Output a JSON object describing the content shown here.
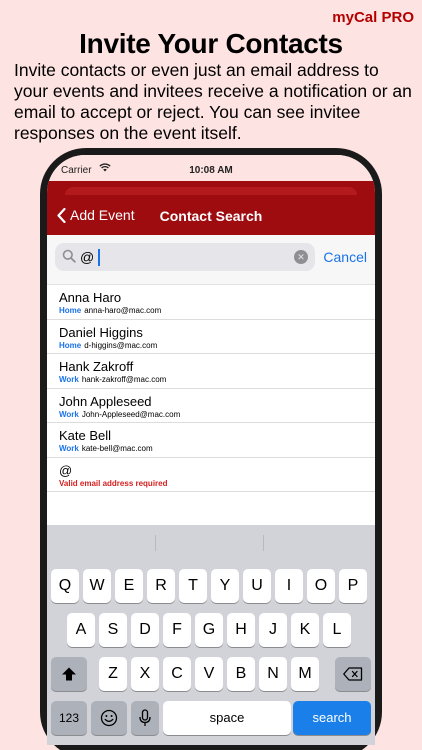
{
  "brand": "myCal PRO",
  "headline": "Invite Your Contacts",
  "description": "Invite contacts or even just an email address to your events and invitees receive a notification or an email to accept or reject. You can see invitee responses on the event itself.",
  "status_bar": {
    "carrier": "Carrier",
    "time": "10:08 AM"
  },
  "nav": {
    "back_label": "Add Event",
    "title": "Contact Search"
  },
  "search": {
    "value": "@",
    "cancel_label": "Cancel"
  },
  "contacts": [
    {
      "name": "Anna Haro",
      "label": "Home",
      "email": "anna-haro@mac.com"
    },
    {
      "name": "Daniel Higgins",
      "label": "Home",
      "email": "d-higgins@mac.com"
    },
    {
      "name": "Hank Zakroff",
      "label": "Work",
      "email": "hank-zakroff@mac.com"
    },
    {
      "name": "John Appleseed",
      "label": "Work",
      "email": "John-Appleseed@mac.com"
    },
    {
      "name": "Kate Bell",
      "label": "Work",
      "email": "kate-bell@mac.com"
    }
  ],
  "email_entry": {
    "value": "@",
    "error": "Valid email address required"
  },
  "keyboard": {
    "row1": [
      "Q",
      "W",
      "E",
      "R",
      "T",
      "Y",
      "U",
      "I",
      "O",
      "P"
    ],
    "row2": [
      "A",
      "S",
      "D",
      "F",
      "G",
      "H",
      "J",
      "K",
      "L"
    ],
    "row3": [
      "Z",
      "X",
      "C",
      "V",
      "B",
      "N",
      "M"
    ],
    "numbers_label": "123",
    "space_label": "space",
    "search_label": "search"
  },
  "colors": {
    "accent_blue": "#1a73e8",
    "nav_red": "#9e0c10",
    "error_red": "#d42020",
    "background": "#fde3e1"
  }
}
